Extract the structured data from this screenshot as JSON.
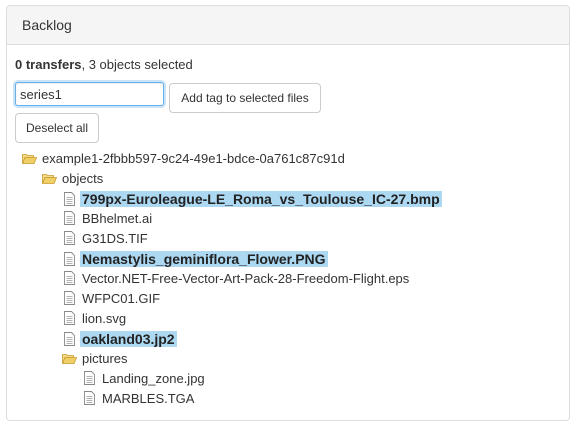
{
  "panel": {
    "title": "Backlog"
  },
  "summary": {
    "transfers_bold": "0 transfers",
    "selected_text": ", 3 objects selected"
  },
  "tag_input": {
    "value": "series1"
  },
  "buttons": {
    "add_tag": "Add tag to selected files",
    "deselect_all": "Deselect all"
  },
  "tree": {
    "root": "example1-2fbbb597-9c24-49e1-bdce-0a761c87c91d",
    "objects_folder": "objects",
    "files": [
      {
        "name": "799px-Euroleague-LE_Roma_vs_Toulouse_IC-27.bmp",
        "selected": true
      },
      {
        "name": "BBhelmet.ai",
        "selected": false
      },
      {
        "name": "G31DS.TIF",
        "selected": false
      },
      {
        "name": "Nemastylis_geminiflora_Flower.PNG",
        "selected": true
      },
      {
        "name": "Vector.NET-Free-Vector-Art-Pack-28-Freedom-Flight.eps",
        "selected": false
      },
      {
        "name": "WFPC01.GIF",
        "selected": false
      },
      {
        "name": "lion.svg",
        "selected": false
      },
      {
        "name": "oakland03.jp2",
        "selected": true
      }
    ],
    "pictures_folder": "pictures",
    "picture_files": [
      {
        "name": "Landing_zone.jpg",
        "selected": false
      },
      {
        "name": "MARBLES.TGA",
        "selected": false
      }
    ]
  },
  "colors": {
    "selection": "#add8f2",
    "input_focus": "#66afe9",
    "folder": "#e8c25a"
  },
  "icons": {
    "folder": "folder-open-icon",
    "file": "file-icon"
  }
}
